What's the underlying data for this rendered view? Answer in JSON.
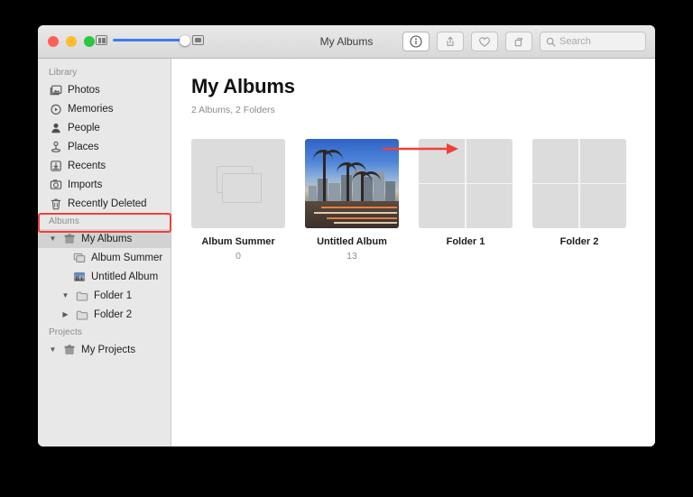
{
  "window": {
    "title": "My Albums",
    "traffic_lights": [
      "close-red",
      "minimize-yellow",
      "maximize-green"
    ]
  },
  "toolbar": {
    "zoom_slider": {
      "min_icon": "small-thumbnails-icon",
      "max_icon": "large-thumbnails-icon",
      "value_percent": 88
    },
    "buttons": [
      {
        "name": "info-button",
        "icon": "info-circle-icon",
        "active": true
      },
      {
        "name": "share-button",
        "icon": "share-icon",
        "active": false
      },
      {
        "name": "favorite-button",
        "icon": "heart-icon",
        "active": false
      },
      {
        "name": "rotate-button",
        "icon": "rotate-icon",
        "active": false
      }
    ],
    "search": {
      "placeholder": "Search",
      "value": "",
      "icon": "search-icon"
    }
  },
  "sidebar": {
    "sections": [
      {
        "label": "Library",
        "items": [
          {
            "label": "Photos",
            "icon": "photos-icon"
          },
          {
            "label": "Memories",
            "icon": "memories-icon"
          },
          {
            "label": "People",
            "icon": "people-icon"
          },
          {
            "label": "Places",
            "icon": "places-pin-icon"
          },
          {
            "label": "Recents",
            "icon": "recents-download-icon"
          },
          {
            "label": "Imports",
            "icon": "imports-camera-icon"
          },
          {
            "label": "Recently Deleted",
            "icon": "trash-icon"
          }
        ]
      },
      {
        "label": "Albums",
        "items": [
          {
            "label": "My Albums",
            "icon": "albums-box-icon",
            "twisty": "expanded",
            "selected": true,
            "indent": 1,
            "highlighted": true
          },
          {
            "label": "Album Summer",
            "icon": "album-stack-icon",
            "twisty": "none",
            "selected": false,
            "indent": 3
          },
          {
            "label": "Untitled Album",
            "icon": "album-photo-icon",
            "twisty": "none",
            "selected": false,
            "indent": 3
          },
          {
            "label": "Folder 1",
            "icon": "folder-icon",
            "twisty": "expanded",
            "selected": false,
            "indent": 2
          },
          {
            "label": "Folder 2",
            "icon": "folder-icon",
            "twisty": "collapsed",
            "selected": false,
            "indent": 2
          }
        ]
      },
      {
        "label": "Projects",
        "items": [
          {
            "label": "My Projects",
            "icon": "projects-box-icon",
            "twisty": "expanded",
            "selected": false,
            "indent": 1
          }
        ]
      }
    ]
  },
  "main": {
    "title": "My Albums",
    "subtitle": "2 Albums, 2 Folders",
    "tiles": [
      {
        "label": "Album Summer",
        "count": "0",
        "kind": "empty-album"
      },
      {
        "label": "Untitled Album",
        "count": "13",
        "kind": "photo-album"
      },
      {
        "label": "Folder 1",
        "count": "",
        "kind": "folder"
      },
      {
        "label": "Folder 2",
        "count": "",
        "kind": "folder"
      }
    ]
  },
  "annotations": {
    "color": "#ef4136",
    "highlight_target": "My Albums",
    "arrow_from": "Untitled Album",
    "arrow_to": "Folder 1"
  }
}
